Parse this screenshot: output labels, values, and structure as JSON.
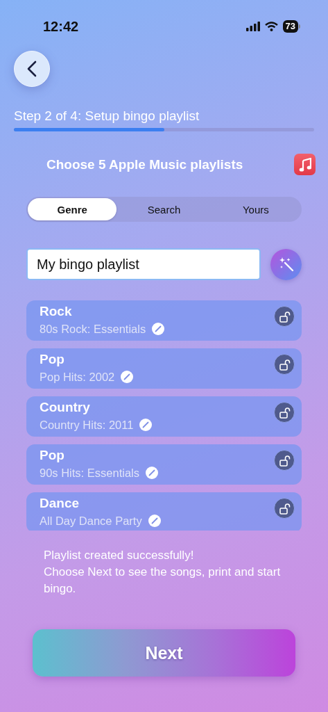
{
  "status_bar": {
    "time": "12:42",
    "battery": "73"
  },
  "progress": {
    "label": "Step 2 of 4: Setup bingo playlist",
    "level": 0.5
  },
  "header": {
    "title": "Choose 5 Apple Music playlists"
  },
  "tabs": [
    {
      "label": "Genre",
      "selected": true
    },
    {
      "label": "Search",
      "selected": false
    },
    {
      "label": "Yours",
      "selected": false
    }
  ],
  "name_field": {
    "value": "My bingo playlist"
  },
  "playlists": [
    {
      "genre": "Rock",
      "name": "80s Rock: Essentials",
      "locked": false
    },
    {
      "genre": "Pop",
      "name": "Pop Hits: 2002",
      "locked": false
    },
    {
      "genre": "Country",
      "name": "Country Hits: 2011",
      "locked": false
    },
    {
      "genre": "Pop",
      "name": "90s Hits: Essentials",
      "locked": false
    },
    {
      "genre": "Dance",
      "name": "All Day Dance Party",
      "locked": false
    }
  ],
  "message": [
    "Playlist created successfully!",
    "Choose Next to see the songs, print and start bingo."
  ],
  "next_button": "Next"
}
